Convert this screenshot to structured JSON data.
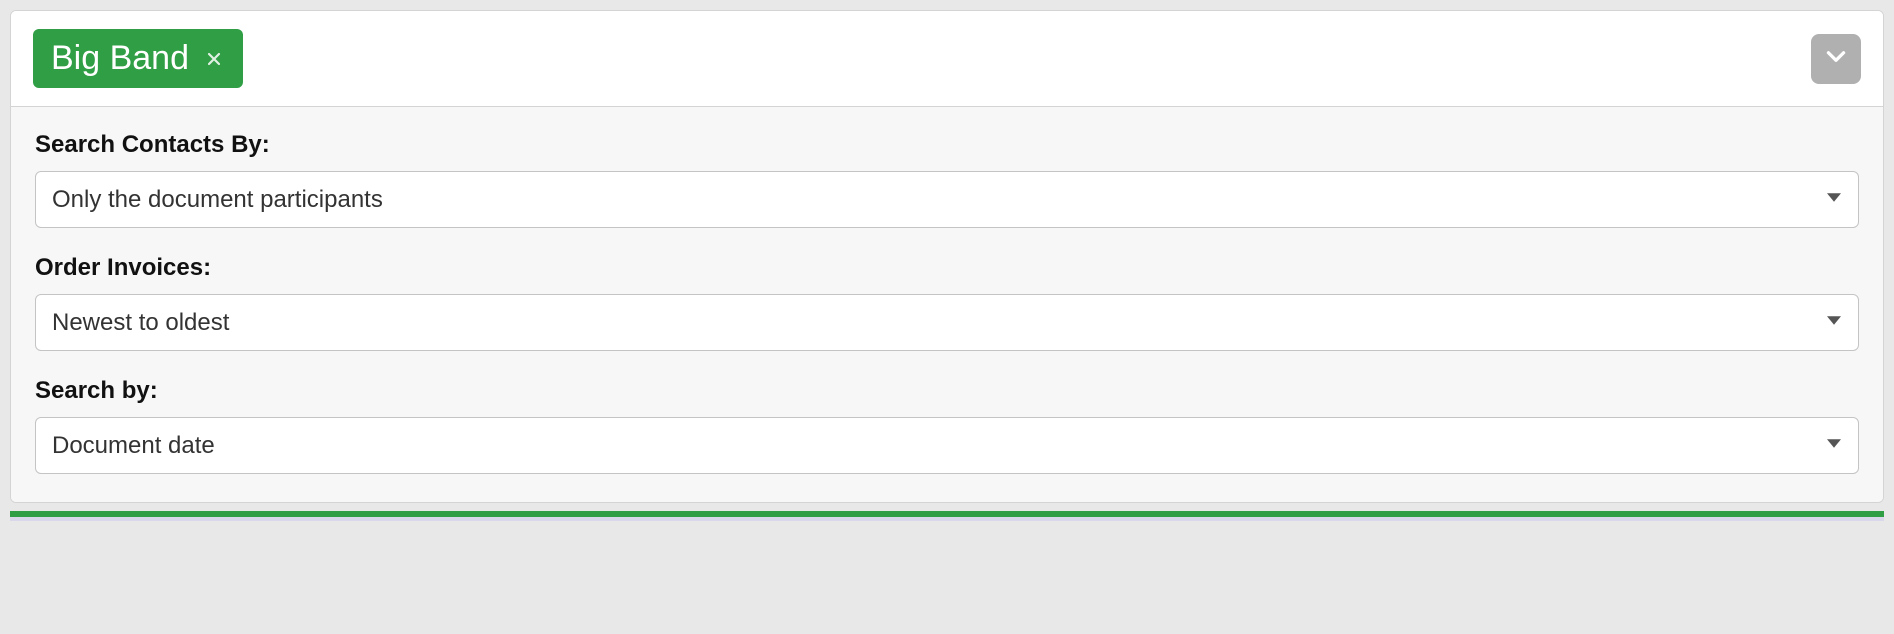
{
  "header": {
    "tag_label": "Big Band"
  },
  "fields": {
    "search_contacts": {
      "label": "Search Contacts By:",
      "value": "Only the document participants"
    },
    "order_invoices": {
      "label": "Order Invoices:",
      "value": "Newest to oldest"
    },
    "search_by": {
      "label": "Search by:",
      "value": "Document date"
    }
  }
}
